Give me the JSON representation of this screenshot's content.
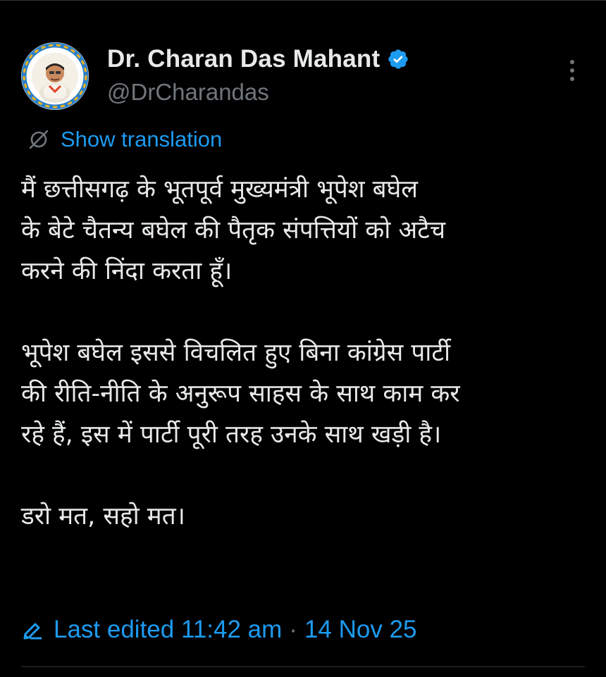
{
  "author": {
    "display_name": "Dr. Charan Das Mahant",
    "handle": "@DrCharandas",
    "verified": true
  },
  "translation": {
    "label": "Show translation"
  },
  "tweet": {
    "paragraphs": [
      "मैं छत्तीसगढ़ के भूतपूर्व मुख्यमंत्री भूपेश बघेल\nके बेटे चैतन्य बघेल की पैतृक संपत्तियों को अटैच\nकरने की निंदा करता हूँ।",
      "भूपेश बघेल इससे विचलित हुए बिना कांग्रेस पार्टी\nकी रीति-नीति के अनुरूप साहस के साथ काम कर\nरहे हैं, इस में पार्टी पूरी तरह उनके साथ खड़ी है।",
      "डरो मत, सहो मत।"
    ]
  },
  "edit_info": {
    "label": "Last edited 11:42 am",
    "separator": "·",
    "date": "14 Nov 25"
  },
  "icons": {
    "verified": "verified-badge-icon",
    "more": "more-vertical-icon",
    "translate": "translate-icon",
    "edited": "pencil-icon"
  },
  "colors": {
    "background": "#000000",
    "text_primary": "#e7e9ea",
    "text_secondary": "#71767b",
    "accent": "#1d9bf0",
    "divider": "#2f3336"
  }
}
